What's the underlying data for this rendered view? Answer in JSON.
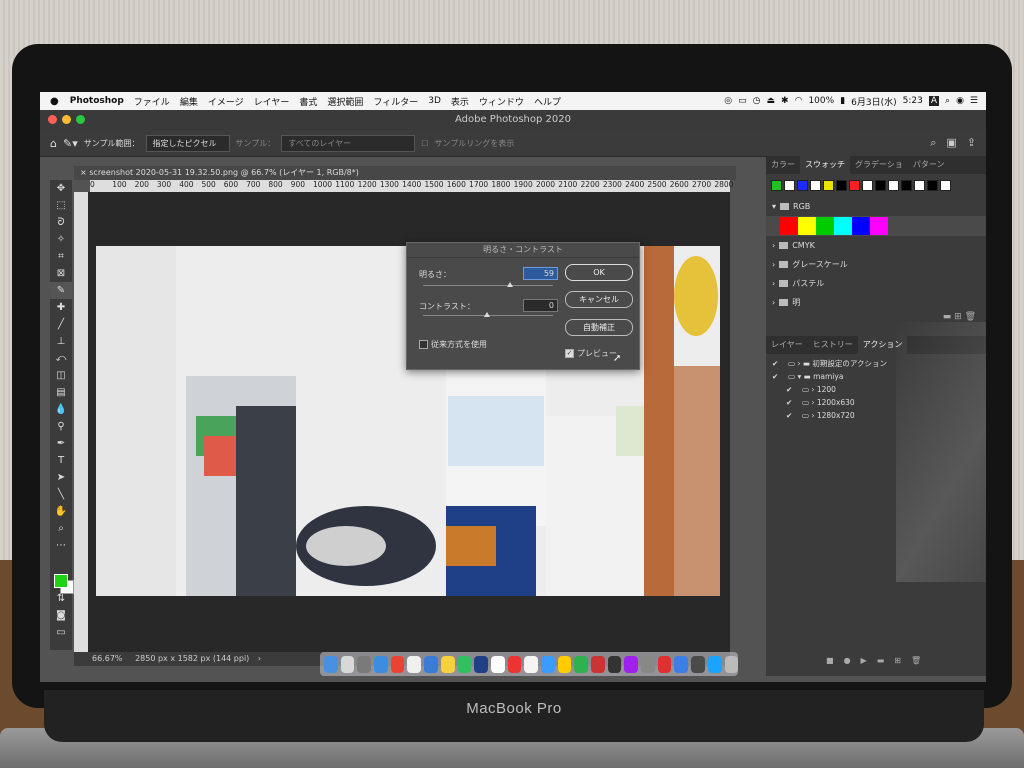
{
  "menubar": {
    "app": "Photoshop",
    "items": [
      "ファイル",
      "編集",
      "イメージ",
      "レイヤー",
      "書式",
      "選択範囲",
      "フィルター",
      "3D",
      "表示",
      "ウィンドウ",
      "ヘルプ"
    ],
    "battery": "100%",
    "date": "6月3日(水)",
    "time": "5:23",
    "input_mode": "A"
  },
  "window": {
    "title": "Adobe Photoshop 2020"
  },
  "options": {
    "sample_size_label": "サンプル範囲：",
    "sample_size_value": "指定したピクセル",
    "sample_label": "サンプル：",
    "sample_value": "すべてのレイヤー",
    "sample_ring": "サンプルリングを表示"
  },
  "document": {
    "tab_title": "screenshot 2020-05-31 19.32.50.png @ 66.7% (レイヤー 1, RGB/8*)",
    "ruler_ticks": [
      "0",
      "100",
      "200",
      "300",
      "400",
      "500",
      "600",
      "700",
      "800",
      "900",
      "1000",
      "1100",
      "1200",
      "1300",
      "1400",
      "1500",
      "1600",
      "1700",
      "1800",
      "1900",
      "2000",
      "2100",
      "2200",
      "2300",
      "2400",
      "2500",
      "2600",
      "2700",
      "2800"
    ],
    "zoom": "66.67%",
    "doc_info": "2850 px x 1582 px (144 ppi)"
  },
  "dialog": {
    "title": "明るさ・コントラスト",
    "brightness_label": "明るさ：",
    "brightness_value": "59",
    "contrast_label": "コントラスト：",
    "contrast_value": "0",
    "legacy_label": "従来方式を使用",
    "preview_label": "プレビュー",
    "ok_label": "OK",
    "cancel_label": "キャンセル",
    "auto_label": "自動補正"
  },
  "swatch_panel": {
    "tabs": [
      "カラー",
      "スウォッチ",
      "グラデーショ",
      "パターン"
    ],
    "active_tab": "スウォッチ",
    "recent": [
      "#21c21e",
      "#ffffff",
      "#1a2cff",
      "#ffffff",
      "#e9e400",
      "#000000",
      "#ff1f1f",
      "#ffffff",
      "#000000",
      "#ffffff",
      "#000000",
      "#ffffff",
      "#000000",
      "#ffffff"
    ],
    "groups": [
      "RGB",
      "CMYK",
      "グレースケール",
      "パステル",
      "明"
    ],
    "rgb_colors": [
      "#ff0000",
      "#ffff00",
      "#00cc00",
      "#00ffff",
      "#0000ff",
      "#ff00ff"
    ]
  },
  "actions_panel": {
    "tabs": [
      "レイヤー",
      "ヒストリー",
      "アクション"
    ],
    "active_tab": "アクション",
    "items": [
      {
        "label": "初期設定のアクション",
        "indent": 0
      },
      {
        "label": "mamiya",
        "indent": 0
      },
      {
        "label": "1200",
        "indent": 1
      },
      {
        "label": "1200x630",
        "indent": 1
      },
      {
        "label": "1280x720",
        "indent": 1
      }
    ]
  },
  "laptop": {
    "brand": "MacBook Pro"
  },
  "colors": {
    "foreground": "#1fd314",
    "background": "#ffffff"
  }
}
